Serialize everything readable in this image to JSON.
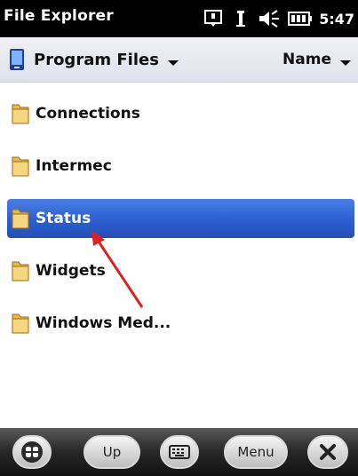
{
  "titlebar": {
    "title": "File Explorer",
    "time": "5:47",
    "icons": [
      "notification-icon",
      "signal-icon",
      "volume-icon",
      "battery-icon"
    ]
  },
  "header": {
    "location": "Program Files",
    "sort": "Name"
  },
  "folders": [
    {
      "name": "Connections",
      "selected": false
    },
    {
      "name": "Intermec",
      "selected": false
    },
    {
      "name": "Status",
      "selected": true
    },
    {
      "name": "Widgets",
      "selected": false
    },
    {
      "name": "Windows Med...",
      "selected": false
    }
  ],
  "taskbar": {
    "up_label": "Up",
    "menu_label": "Menu",
    "icons": [
      "windows-start-icon",
      "keyboard-icon",
      "close-icon"
    ]
  },
  "colors": {
    "selection": "#2c5fd0",
    "annotation_arrow": "#e02020"
  }
}
